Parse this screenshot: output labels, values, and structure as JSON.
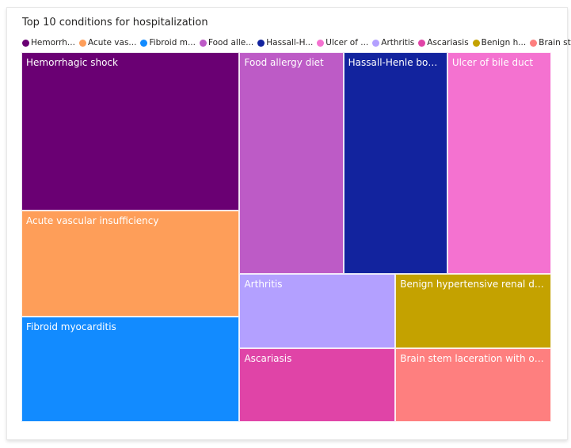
{
  "chart_data": {
    "type": "treemap",
    "title": "Top 10 conditions for hospitalization",
    "legend_position": "top-left",
    "legend": [
      {
        "label": "Hemorrh...",
        "color": "#6a0073"
      },
      {
        "label": "Acute vas...",
        "color": "#fe9e59"
      },
      {
        "label": "Fibroid m...",
        "color": "#128bff"
      },
      {
        "label": "Food alle...",
        "color": "#bd5bc6"
      },
      {
        "label": "Hassall-H...",
        "color": "#12239e"
      },
      {
        "label": "Ulcer of ...",
        "color": "#f472d0"
      },
      {
        "label": "Arthritis",
        "color": "#b3a0ff"
      },
      {
        "label": "Ascariasis",
        "color": "#e044a7"
      },
      {
        "label": "Benign h...",
        "color": "#c4a200"
      },
      {
        "label": "Brain ste...",
        "color": "#fe7f7f"
      }
    ],
    "items": [
      {
        "name": "Hemorrhagic shock",
        "label": "Hemorrhagic shock",
        "value": 3,
        "color": "#6a0073"
      },
      {
        "name": "Acute vascular insufficiency",
        "label": "Acute vascular insufficiency",
        "value": 2,
        "color": "#fe9e59"
      },
      {
        "name": "Fibroid myocarditis",
        "label": "Fibroid myocarditis",
        "value": 2,
        "color": "#128bff"
      },
      {
        "name": "Food allergy diet",
        "label": "Food allergy diet",
        "value": 2,
        "color": "#bd5bc6"
      },
      {
        "name": "Hassall-Henle bodies",
        "label": "Hassall-Henle bodies",
        "value": 2,
        "color": "#12239e"
      },
      {
        "name": "Ulcer of bile duct",
        "label": "Ulcer of bile duct",
        "value": 2,
        "color": "#f472d0"
      },
      {
        "name": "Arthritis",
        "label": "Arthritis",
        "value": 1,
        "color": "#b3a0ff"
      },
      {
        "name": "Benign hypertensive renal disease",
        "label": "Benign hypertensive renal disease",
        "value": 1,
        "color": "#c4a200"
      },
      {
        "name": "Ascariasis",
        "label": "Ascariasis",
        "value": 1,
        "color": "#e044a7"
      },
      {
        "name": "Brain stem laceration with open intracranial wound",
        "label": "Brain stem laceration with open i...",
        "value": 1,
        "color": "#fe7f7f"
      }
    ]
  }
}
